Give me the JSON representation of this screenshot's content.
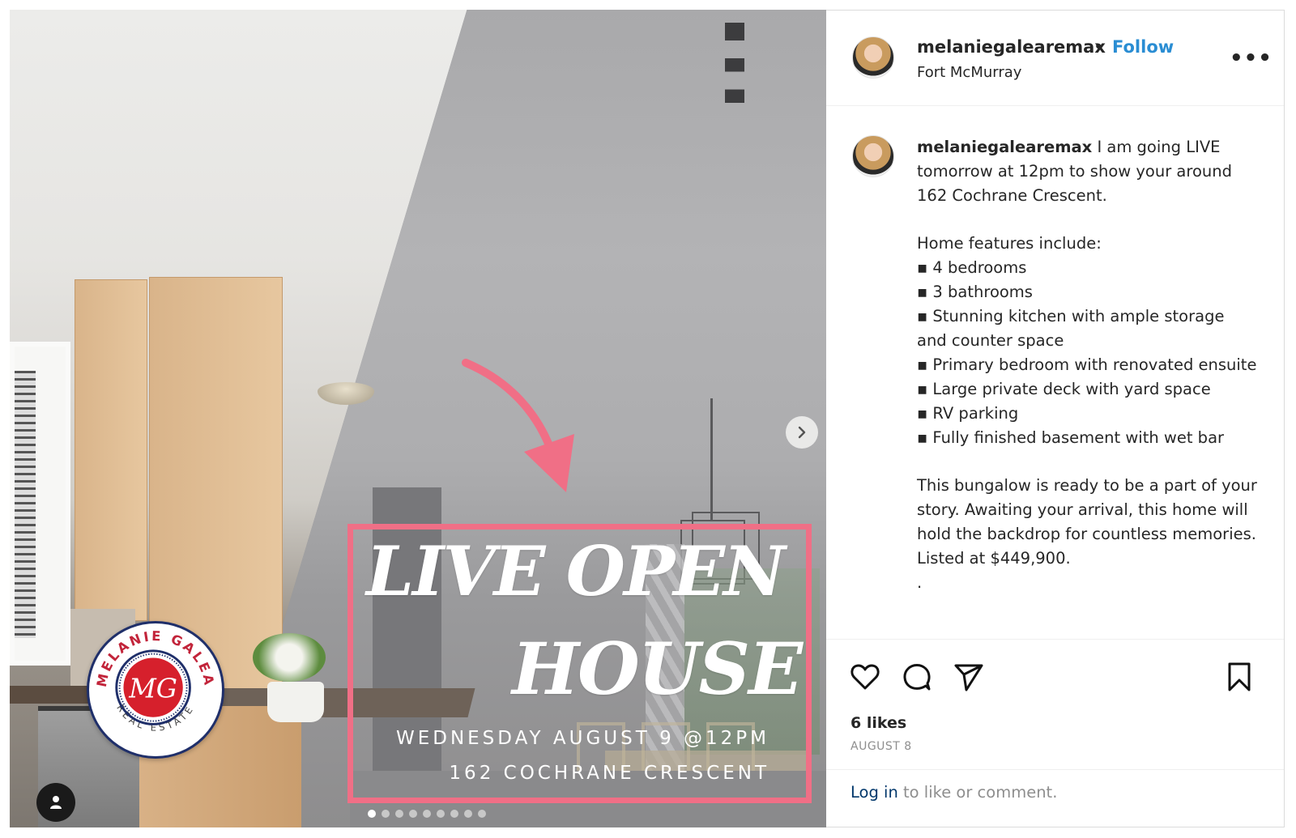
{
  "post_image": {
    "headline_line1": "LIVE OPEN",
    "headline_line2": "HOUSE",
    "event_line": "WEDNESDAY AUGUST 9 @12PM",
    "address_line": "162 COCHRANE CRESCENT",
    "logo": {
      "top_text": "MELANIE GALEA",
      "bottom_text": "REAL ESTATE",
      "monogram": "MG",
      "red": "#d6202c",
      "navy": "#1f2f6a"
    },
    "accent_color": "#f06f86",
    "carousel": {
      "total": 9,
      "active_index": 0
    },
    "next_icon": "chevron-right-icon",
    "tag_icon": "user-tag-icon"
  },
  "header": {
    "username": "melaniegalearemax",
    "separator": "•",
    "follow_label": "Follow",
    "follow_color": "#2a8dd3",
    "location": "Fort McMurray",
    "more_label": "•••"
  },
  "caption": {
    "username": "melaniegalearemax",
    "intro": " I am going LIVE tomorrow at 12pm to show your around 162 Cochrane Crescent.",
    "features_heading": "Home features include:",
    "features": [
      "▪ 4 bedrooms",
      "▪ 3 bathrooms",
      "▪ Stunning kitchen with ample storage and counter space",
      "▪ Primary bedroom with renovated ensuite",
      "▪ Large private deck with yard space",
      "▪ RV parking",
      "▪ Fully finished basement with wet bar"
    ],
    "closing": "This bungalow is ready to be a part of your story. Awaiting your arrival, this home will hold the backdrop for countless memories. Listed at $449,900.",
    "trailing": "."
  },
  "actions": {
    "icons": [
      "heart-icon",
      "comment-icon",
      "share-icon",
      "bookmark-icon"
    ],
    "likes": "6 likes",
    "date": "AUGUST 8"
  },
  "login_prompt": {
    "link": "Log in",
    "rest": " to like or comment."
  }
}
